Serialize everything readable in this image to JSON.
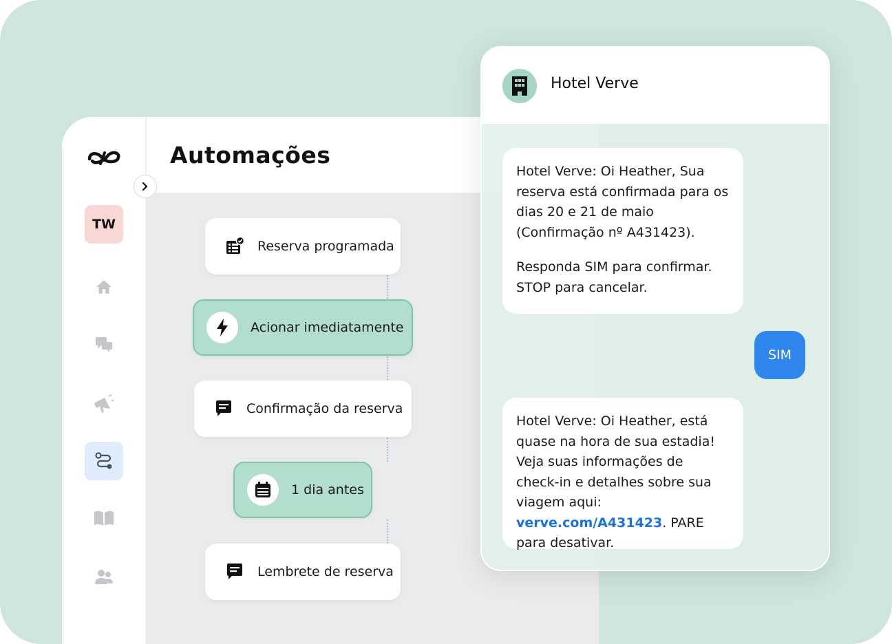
{
  "sidebar": {
    "avatar_initials": "TW",
    "nav": [
      "home-icon",
      "chat-icon",
      "megaphone-icon",
      "automation-icon",
      "book-icon",
      "users-icon"
    ],
    "active_item": "automation-icon"
  },
  "header": {
    "title": "Automações"
  },
  "flow": {
    "nodes": [
      {
        "label": "Reserva programada",
        "icon": "scheduled-list-icon"
      },
      {
        "label": "Acionar imediatamente",
        "icon": "lightning-icon"
      },
      {
        "label": "Confirmação da reserva",
        "icon": "message-icon"
      },
      {
        "label": "1 dia antes",
        "icon": "calendar-icon"
      },
      {
        "label": "Lembrete de reserva",
        "icon": "message-icon"
      }
    ]
  },
  "chat": {
    "name": "Hotel Verve",
    "messages": [
      {
        "p1": "Hotel Verve: Oi Heather, Sua reserva está confirmada para os dias 20 e 21 de maio (Confirmação nº A431423).",
        "p2": "Responda SIM para confirmar. STOP para cancelar."
      },
      {
        "reply": "SIM"
      },
      {
        "before": "Hotel Verve: Oi Heather, está quase na hora de sua estadia! Veja suas informações de check-in e detalhes sobre sua viagem aqui: ",
        "link": "verve.com/A431423",
        "after": ". PARE para desativar."
      }
    ]
  },
  "colors": {
    "background": "#cde5db",
    "accent_green": "#b2decd",
    "sent_bubble": "#2f86ec",
    "link": "#1a73d9"
  }
}
